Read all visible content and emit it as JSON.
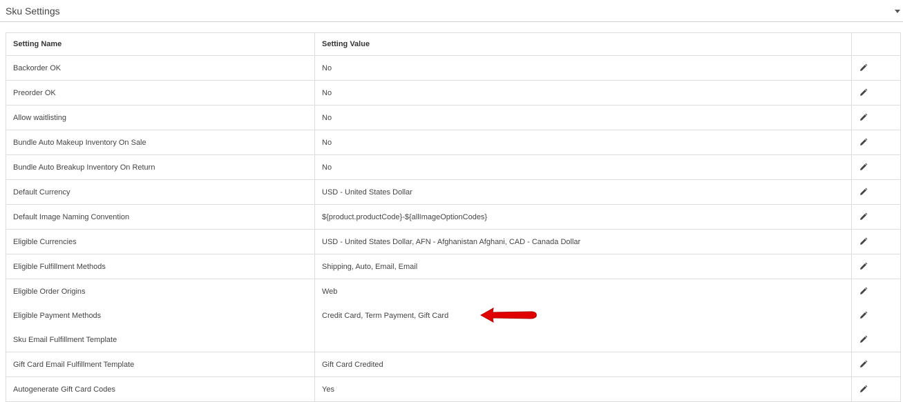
{
  "panel": {
    "title": "Sku Settings"
  },
  "table": {
    "headers": {
      "name": "Setting Name",
      "value": "Setting Value",
      "actions": ""
    },
    "rows": [
      {
        "name": "Backorder OK",
        "value": "No"
      },
      {
        "name": "Preorder OK",
        "value": "No"
      },
      {
        "name": "Allow waitlisting",
        "value": "No"
      },
      {
        "name": "Bundle Auto Makeup Inventory On Sale",
        "value": "No"
      },
      {
        "name": "Bundle Auto Breakup Inventory On Return",
        "value": "No"
      },
      {
        "name": "Default Currency",
        "value": "USD - United States Dollar"
      },
      {
        "name": "Default Image Naming Convention",
        "value": "${product.productCode}-${allImageOptionCodes}"
      },
      {
        "name": "Eligible Currencies",
        "value": "USD - United States Dollar, AFN - Afghanistan Afghani, CAD - Canada Dollar"
      },
      {
        "name": "Eligible Fulfillment Methods",
        "value": "Shipping, Auto, Email, Email"
      },
      {
        "name": "Eligible Order Origins",
        "value": "Web"
      },
      {
        "name": "Eligible Payment Methods",
        "value": "Credit Card, Term Payment, Gift Card"
      },
      {
        "name": "Sku Email Fulfillment Template",
        "value": ""
      },
      {
        "name": "Gift Card Email Fulfillment Template",
        "value": "Gift Card Credited"
      },
      {
        "name": "Autogenerate Gift Card Codes",
        "value": "Yes"
      }
    ]
  },
  "icons": {
    "edit": "pencil-icon",
    "toggle": "caret-down-icon",
    "annotation": "red-arrow-icon"
  },
  "colors": {
    "arrow": "#e00000",
    "border": "#dcdcdc",
    "text": "#444444"
  }
}
